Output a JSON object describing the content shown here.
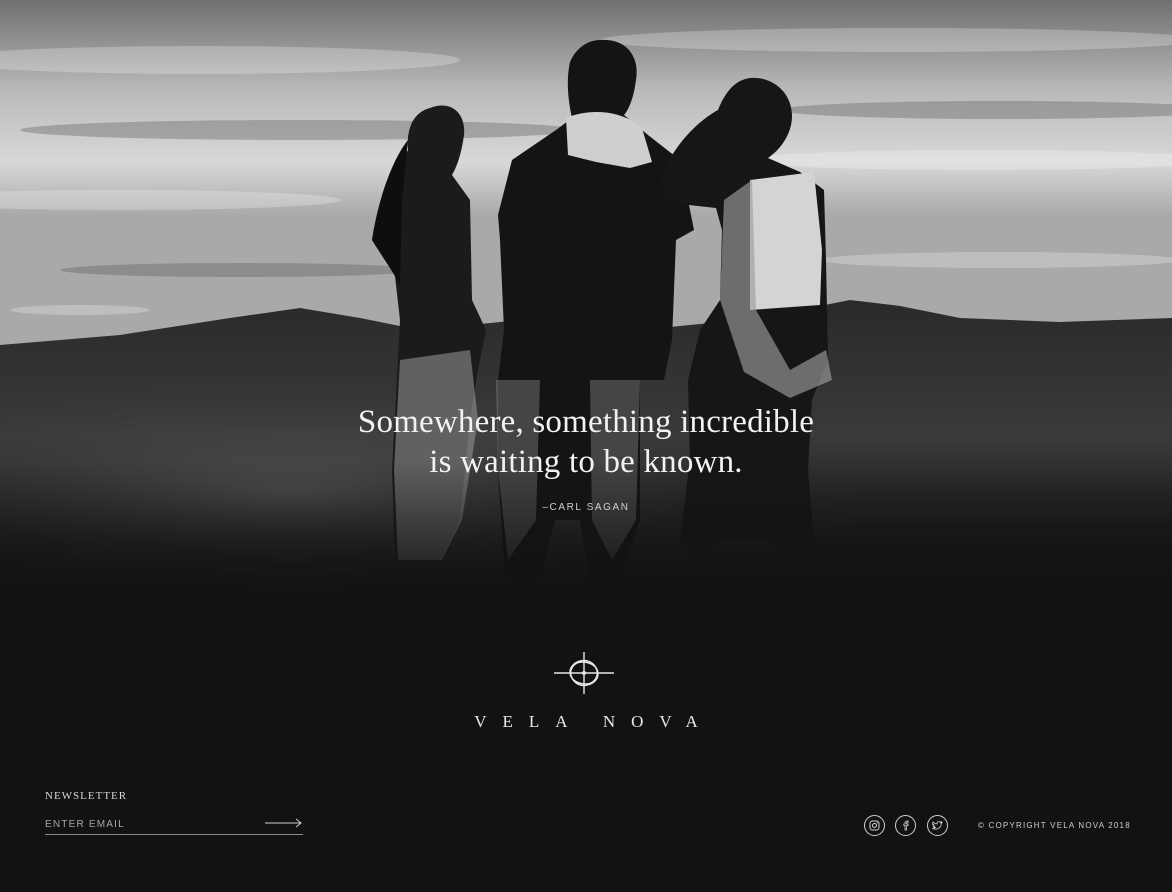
{
  "hero": {
    "quote_line1": "Somewhere, something incredible",
    "quote_line2": "is waiting to be known.",
    "attribution": "–CARL SAGAN"
  },
  "brand": {
    "name": "VELA NOVA",
    "logo_icon": "compass-star-icon"
  },
  "newsletter": {
    "label": "NEWSLETTER",
    "placeholder": "ENTER EMAIL",
    "value": "",
    "submit_icon": "arrow-right-icon"
  },
  "social": [
    {
      "name": "instagram",
      "icon": "instagram-icon"
    },
    {
      "name": "facebook",
      "icon": "facebook-icon"
    },
    {
      "name": "twitter",
      "icon": "twitter-icon"
    }
  ],
  "footer": {
    "copyright": "© COPYRIGHT VELA NOVA 2018"
  },
  "colors": {
    "background": "#121212",
    "text": "#f2f2f2",
    "muted": "#cfcfcf"
  }
}
